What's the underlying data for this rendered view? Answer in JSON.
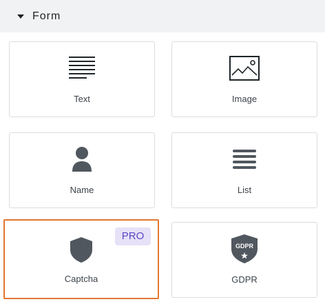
{
  "section": {
    "title": "Form"
  },
  "fields": [
    {
      "label": "Text",
      "icon": "text-lines-icon"
    },
    {
      "label": "Image",
      "icon": "image-icon"
    },
    {
      "label": "Name",
      "icon": "person-icon"
    },
    {
      "label": "List",
      "icon": "list-icon"
    },
    {
      "label": "Captcha",
      "icon": "shield-icon",
      "badge": "PRO",
      "selected": true
    },
    {
      "label": "GDPR",
      "icon": "gdpr-shield-icon",
      "icon_text": "GDPR"
    }
  ],
  "colors": {
    "header_bg": "#f1f2f3",
    "card_border": "#dcdcde",
    "selected_border": "#e27730",
    "icon": "#50575e",
    "pro_badge_bg": "#e6e1f7",
    "pro_badge_text": "#5b48c2"
  }
}
